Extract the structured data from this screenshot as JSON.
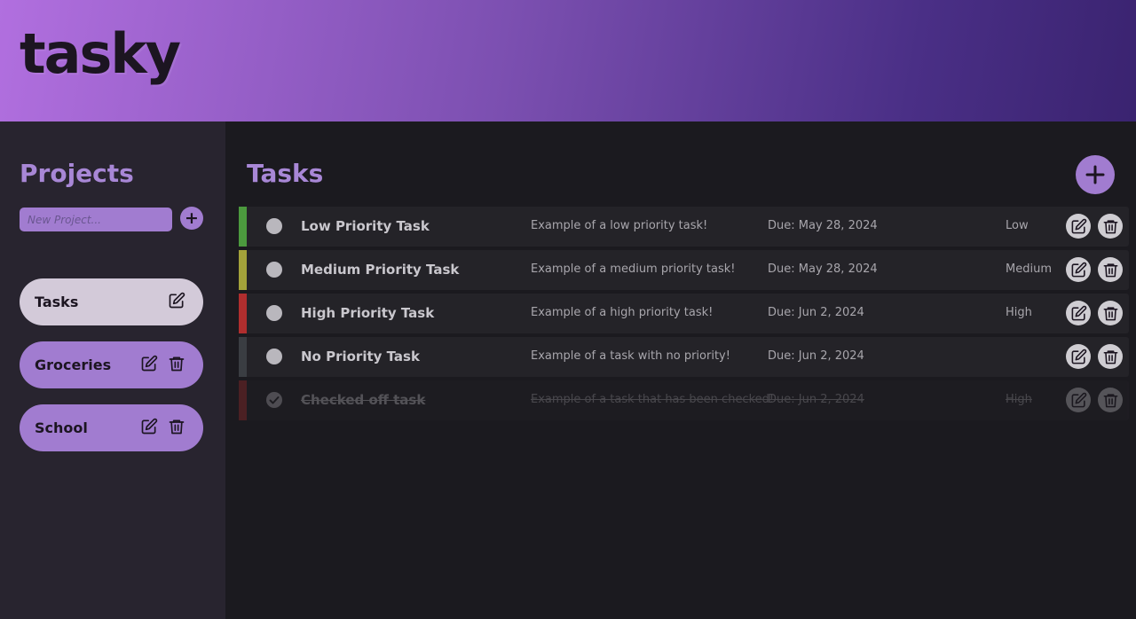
{
  "app": {
    "logo": "tasky"
  },
  "sidebar": {
    "title": "Projects",
    "new_project_placeholder": "New Project...",
    "add_label": "+",
    "projects": [
      {
        "label": "Tasks",
        "active": true
      },
      {
        "label": "Groceries",
        "active": false
      },
      {
        "label": "School",
        "active": false
      }
    ]
  },
  "main": {
    "title": "Tasks",
    "tasks": [
      {
        "title": "Low Priority Task",
        "description": "Example of a low priority task!",
        "due": "Due: May 28, 2024",
        "priority": "Low",
        "color": "#4c9a3e",
        "done": false
      },
      {
        "title": "Medium Priority Task",
        "description": "Example of a medium priority task!",
        "due": "Due: May 28, 2024",
        "priority": "Medium",
        "color": "#a3a23a",
        "done": false
      },
      {
        "title": "High Priority Task",
        "description": "Example of a high priority task!",
        "due": "Due: Jun 2, 2024",
        "priority": "High",
        "color": "#b02e2e",
        "done": false
      },
      {
        "title": "No Priority Task",
        "description": "Example of a task with no priority!",
        "due": "Due: Jun 2, 2024",
        "priority": "",
        "color": "#3a3d42",
        "done": false
      },
      {
        "title": "Checked off task",
        "description": "Example of a task that has been checked!",
        "due": "Due: Jun 2, 2024",
        "priority": "High",
        "color": "#b02e2e",
        "done": true
      }
    ]
  },
  "colors": {
    "accent": "#a17cd0",
    "heading": "#a887d6",
    "active_project": "#d3cad9",
    "background": "#1b1a1f",
    "sidebar": "#28242f"
  }
}
